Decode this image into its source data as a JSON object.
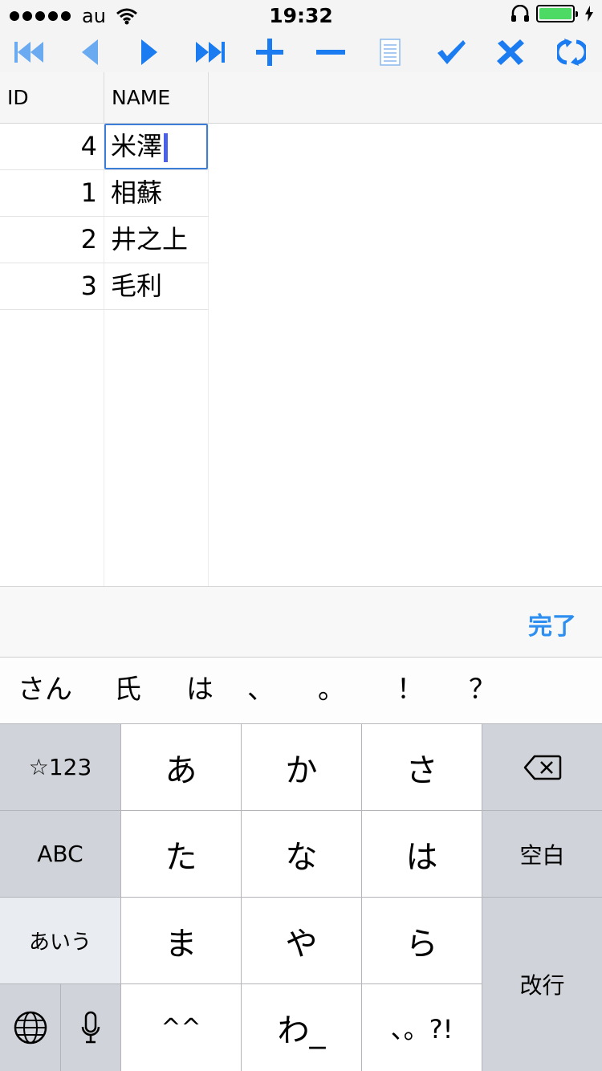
{
  "status": {
    "carrier": "au",
    "time": "19:32"
  },
  "toolbar": {
    "icons": [
      "first-record-icon",
      "previous-record-icon",
      "next-record-icon",
      "last-record-icon",
      "add-record-icon",
      "delete-record-icon",
      "document-icon",
      "confirm-icon",
      "cancel-icon",
      "refresh-icon"
    ],
    "accent": "#1a7cf0"
  },
  "grid": {
    "columns": [
      "ID",
      "NAME"
    ],
    "rows": [
      {
        "id": "4",
        "name": "米澤",
        "editing": true
      },
      {
        "id": "1",
        "name": "相蘇"
      },
      {
        "id": "2",
        "name": "井之上"
      },
      {
        "id": "3",
        "name": "毛利"
      }
    ]
  },
  "accessory": {
    "done_label": "完了"
  },
  "candidates": [
    "さん",
    "氏",
    "は",
    "、",
    "。",
    "！",
    "？"
  ],
  "keyboard": {
    "symbols": "☆123",
    "abc": "ABC",
    "kana_mode": "あいう",
    "keys_row1": [
      "あ",
      "か",
      "さ"
    ],
    "keys_row2": [
      "た",
      "な",
      "は"
    ],
    "keys_row3": [
      "ま",
      "や",
      "ら"
    ],
    "keys_row4": [
      "^^",
      "わ_",
      "、。?!"
    ],
    "space": "空白",
    "return": "改行"
  }
}
